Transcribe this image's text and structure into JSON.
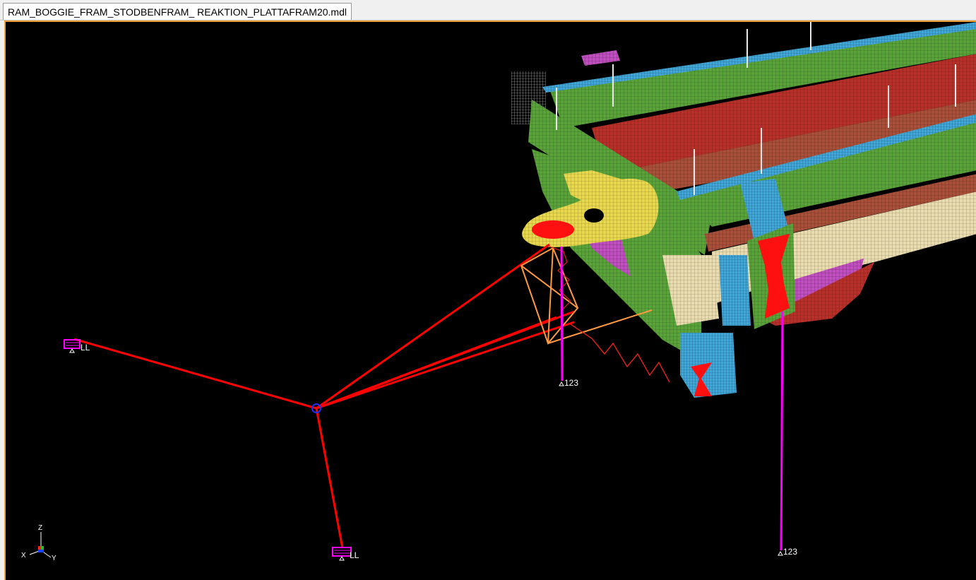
{
  "tab": {
    "title": "RAM_BOGGIE_FRAM_STODBENFRAM_ REAKTION_PLATTAFRAM20.mdl"
  },
  "constraints": {
    "left_label": "LL",
    "bottom_label": "LL",
    "mid_label": "123",
    "right_label": "123"
  },
  "triad": {
    "z": "Z",
    "x": "X",
    "y": "Y"
  },
  "colors": {
    "background": "#000000",
    "viewport_border": "#f0a030",
    "rigid": "#ff0000",
    "spring": "#ff8c30",
    "constraint": "#ff00ff",
    "mesh_green": "#5aa23a",
    "mesh_red": "#c0302a",
    "mesh_yellow": "#e8d850",
    "mesh_blue": "#40a8d8",
    "mesh_beige": "#e8dcb0"
  }
}
